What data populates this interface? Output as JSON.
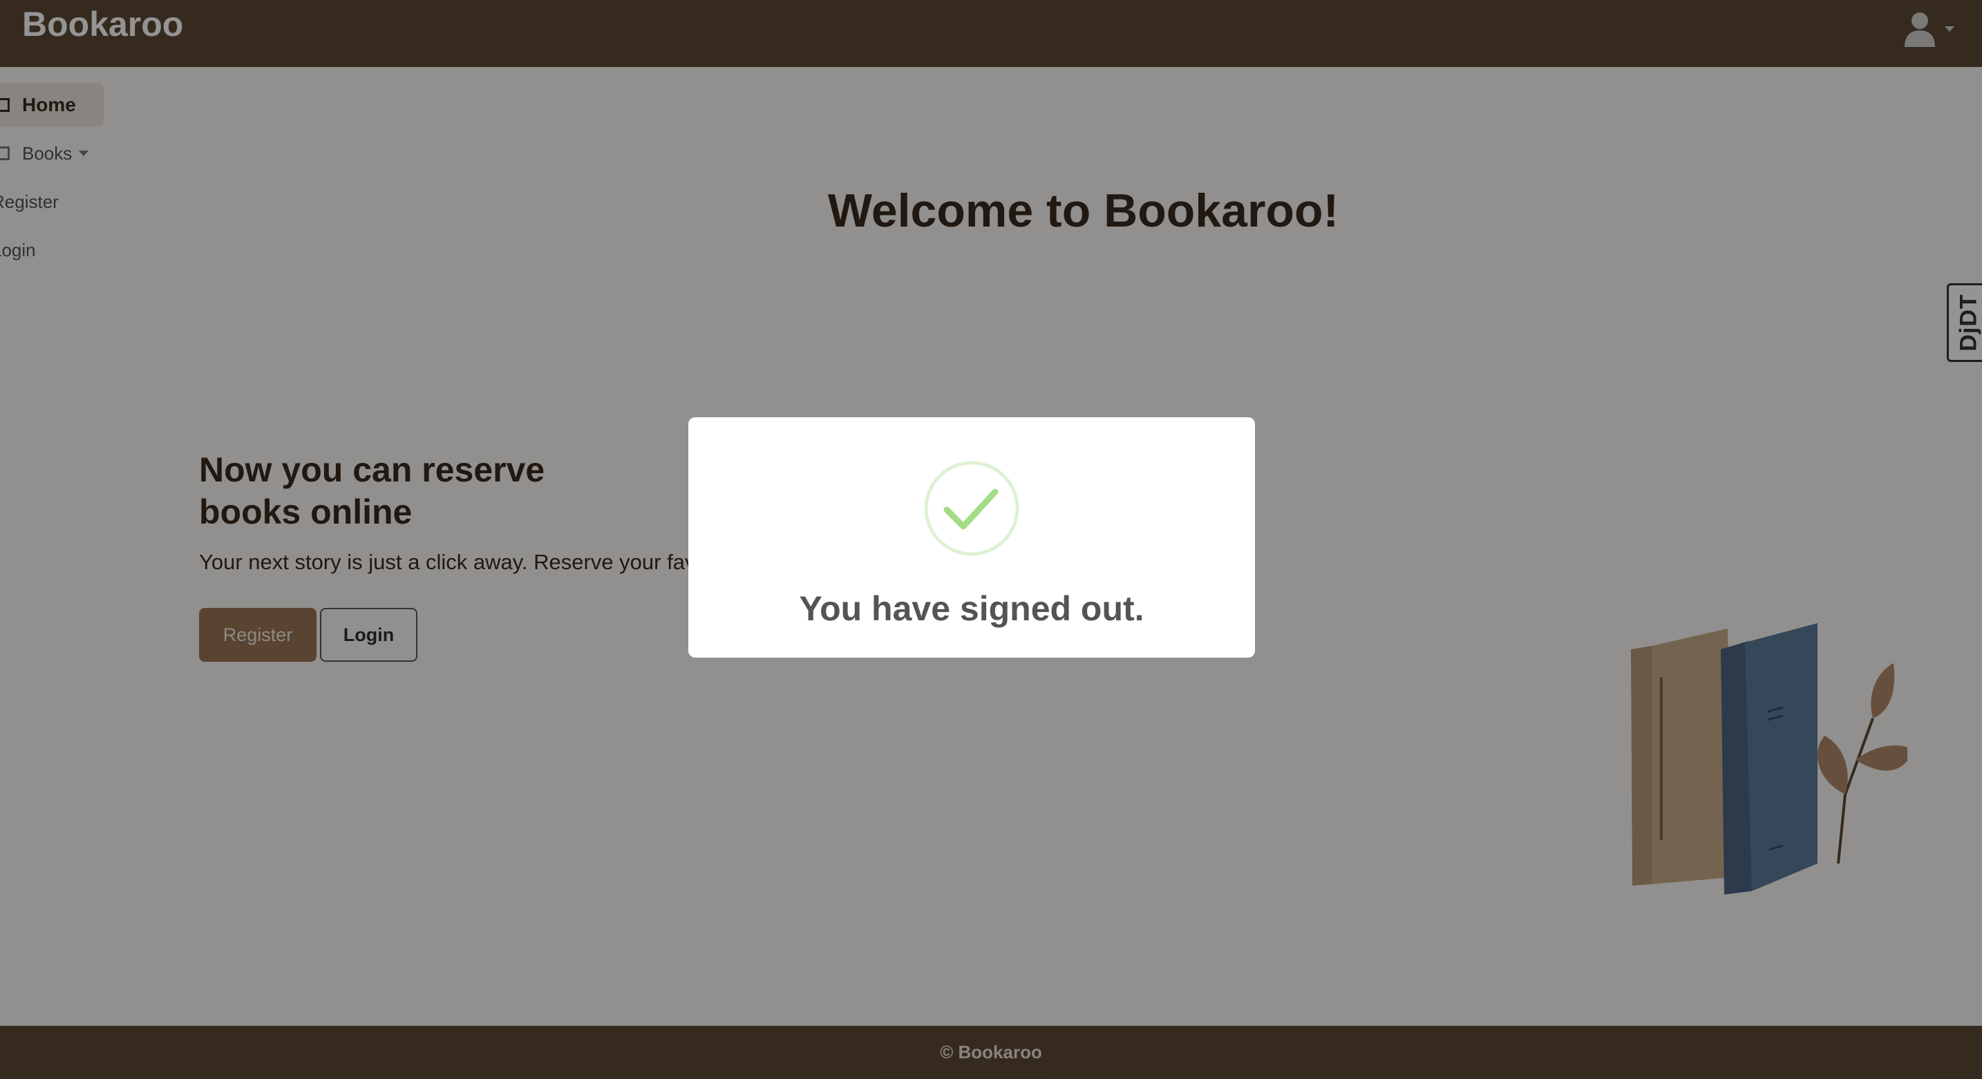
{
  "navbar": {
    "brand": "Bookaroo",
    "user_icon": "user-icon"
  },
  "sidebar": {
    "items": [
      {
        "label": "Home",
        "icon": "book-icon",
        "active": true
      },
      {
        "label": "Books",
        "icon": "book-icon"
      },
      {
        "label": "Register"
      },
      {
        "label": "Login"
      }
    ]
  },
  "main": {
    "welcome": "Welcome to Bookaroo!",
    "hero": {
      "title": "Now you can reserve books online",
      "subtitle": "Your next story is just a click away. Reserve your favo",
      "register_button": "Register",
      "login_button": "Login"
    }
  },
  "djdt": {
    "label": "DjDT"
  },
  "footer": {
    "text": "© Bookaroo"
  },
  "modal": {
    "title": "You have signed out.",
    "icon": "success-check-icon"
  },
  "colors": {
    "navbar": "#5e4936",
    "accent": "#9a7555",
    "success": "#a5dc86",
    "text_dark": "#3a2a1e"
  }
}
